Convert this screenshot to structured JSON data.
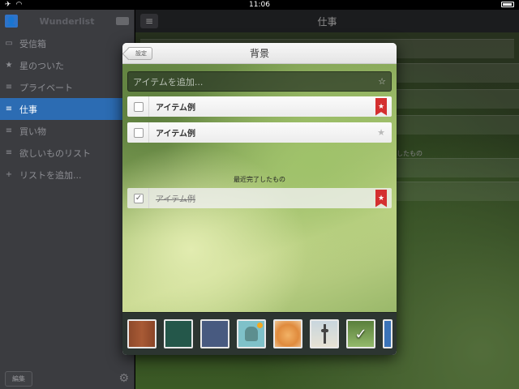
{
  "status": {
    "time": "11:06"
  },
  "sidebar": {
    "brand": "Wunderlist",
    "items": [
      {
        "icon": "inbox-icon",
        "glyph": "▭",
        "label": "受信箱"
      },
      {
        "icon": "star-icon",
        "glyph": "★",
        "label": "星のついた"
      },
      {
        "icon": "list-icon",
        "glyph": "≡",
        "label": "プライベート"
      },
      {
        "icon": "list-icon",
        "glyph": "≡",
        "label": "仕事",
        "active": true
      },
      {
        "icon": "list-icon",
        "glyph": "≡",
        "label": "買い物"
      },
      {
        "icon": "list-icon",
        "glyph": "≡",
        "label": "欲しいものリスト"
      },
      {
        "icon": "plus-icon",
        "glyph": "+",
        "label": "リストを追加..."
      }
    ],
    "edit_label": "編集"
  },
  "main": {
    "title": "仕事",
    "section_fragment": "したもの"
  },
  "modal": {
    "back_label": "設定",
    "title": "背景",
    "add_placeholder": "アイテムを追加...",
    "tasks": [
      {
        "label": "アイテム例",
        "starred": true
      },
      {
        "label": "アイテム例",
        "starred": false
      }
    ],
    "completed_heading": "最近完了したもの",
    "completed": [
      {
        "label": "アイテム例",
        "starred": true
      }
    ],
    "themes": [
      {
        "name": "wood"
      },
      {
        "name": "dark-green"
      },
      {
        "name": "slate-blue"
      },
      {
        "name": "monster"
      },
      {
        "name": "cat"
      },
      {
        "name": "tower"
      },
      {
        "name": "grass",
        "selected": true
      },
      {
        "name": "blue"
      }
    ]
  },
  "colors": {
    "accent": "#2c6cb3",
    "ribbon": "#d42f2f"
  }
}
